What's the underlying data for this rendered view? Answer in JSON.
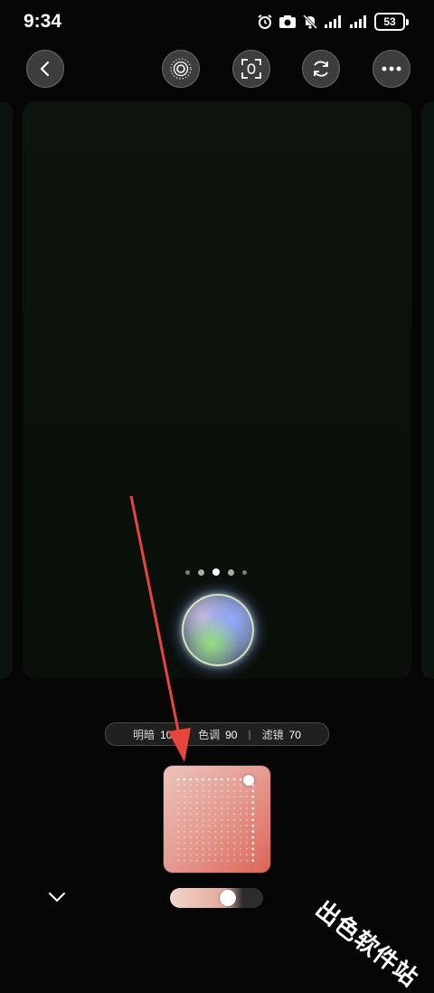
{
  "status_bar": {
    "time": "9:34",
    "battery": "53",
    "icons": [
      "alarm-icon",
      "camera-icon",
      "mute-icon",
      "signal-icon",
      "signal-icon",
      "battery-icon"
    ]
  },
  "toolbar": {
    "back_icon": "back-arrow-icon",
    "buttons": [
      "ripple-icon",
      "focus-frame-icon",
      "refresh-icon",
      "more-icon"
    ]
  },
  "carousel": {
    "page_count": 5,
    "active_page": 3
  },
  "info_pill": {
    "brightness_label": "明暗",
    "brightness_value": "100",
    "hue_label": "色调",
    "hue_value": "90",
    "separator": "|",
    "filter_label": "滤镜",
    "filter_value": "70"
  },
  "color_pad": {
    "gradient_from": "#ecc3bb",
    "gradient_to": "#dd6458"
  },
  "bottom": {
    "collapse_icon": "chevron-down-icon",
    "slider_level": 0.66
  },
  "annotation": {
    "arrow_color": "#e8453c"
  },
  "watermark": {
    "text": "出色软件站"
  }
}
